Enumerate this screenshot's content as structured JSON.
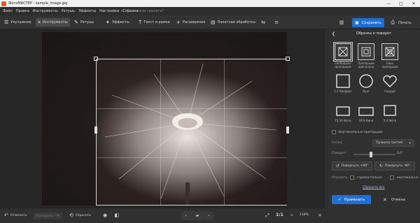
{
  "window": {
    "title": "ФотоМАСТЕР - sample_image.jpg",
    "controls": [
      "—",
      "□",
      "✕"
    ]
  },
  "menu": {
    "items": [
      "Файл",
      "Правка",
      "Инструменты",
      "Ретушь",
      "Эффекты",
      "Настройки",
      "Справка"
    ],
    "search_placeholder": "Вы хотели сделать?"
  },
  "toolbar": {
    "tabs": [
      {
        "label": "Улучшение",
        "icon": "sliders-icon"
      },
      {
        "label": "Инструменты",
        "icon": "crop-icon"
      },
      {
        "label": "Ретушь",
        "icon": "brush-icon"
      },
      {
        "label": "Эффекты",
        "icon": "sparkle-icon"
      },
      {
        "label": "Текст и рамки",
        "icon": "text-icon"
      },
      {
        "label": "Расширения",
        "icon": "plus-icon"
      },
      {
        "label": "Пакетная обработка",
        "icon": "batch-icon"
      }
    ],
    "active_tab": "Инструменты",
    "save_label": "Сохранить",
    "print_label": "Печать"
  },
  "panel": {
    "title": "Обрезка и поворот",
    "ratios": [
      {
        "label": "Свободные пропорции",
        "selected": true
      },
      {
        "label": "Пропорции оригинала",
        "selected": false
      },
      {
        "label": "Свои пропорции",
        "selected": false
      }
    ],
    "shapes": [
      {
        "label": "1:1 Квадрат"
      },
      {
        "label": "Круг"
      },
      {
        "label": "Сердце"
      },
      {
        "label": "15:10 Фото"
      },
      {
        "label": "16:9 Кино"
      },
      {
        "label": "5:4 Фото"
      }
    ],
    "vertical_label": "Вертикальные пропорции",
    "grid_label": "Сетка:",
    "grid_value": "Правило третей",
    "rotation_label": "Поворот:",
    "rotation_value": "0,0°",
    "rotate_left_label": "Повернуть +90°",
    "rotate_right_label": "Повернуть -90°",
    "flip_label": "Отразить",
    "flip_horizontal": "горизонтально",
    "flip_vertical": "вертикально",
    "reset_all_label": "Сбросить все",
    "apply_label": "Применить",
    "cancel_label": "Отмена"
  },
  "bottom": {
    "undo_label": "Отменить",
    "redo_label": "Повторить",
    "reset_label": "Сбросить",
    "zoom_ratio": "1:1",
    "zoom_value": "118%"
  },
  "colors": {
    "accent": "#1e6fd6",
    "background": "#2b2b2b",
    "panel": "#303030"
  }
}
